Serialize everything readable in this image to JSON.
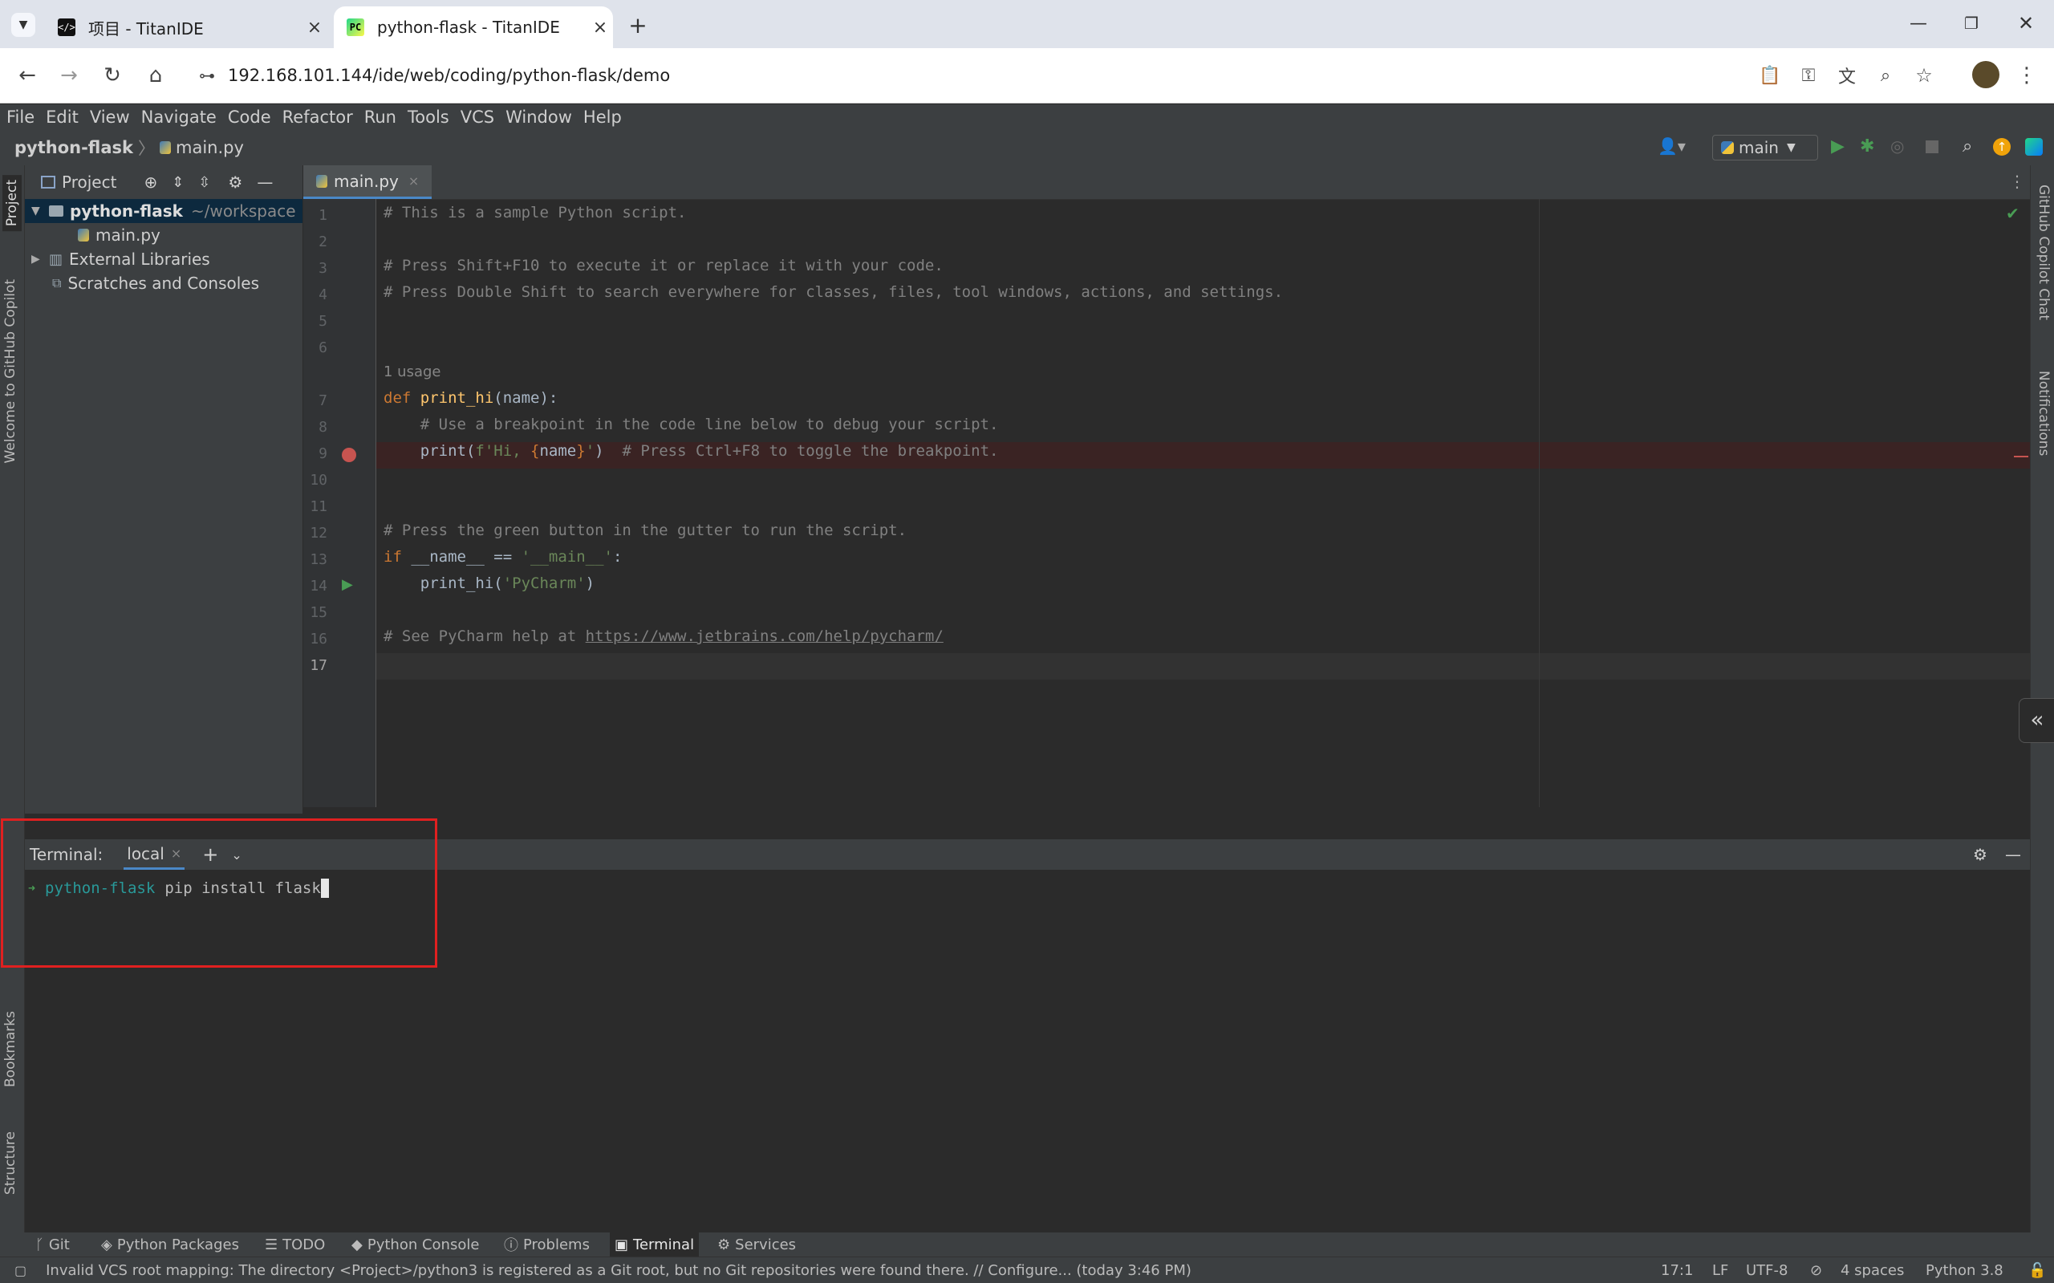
{
  "browser": {
    "tabs": [
      {
        "title": "项目 - TitanIDE",
        "favicon": "titanide-icon"
      },
      {
        "title": "python-flask - TitanIDE",
        "favicon": "pycharm-icon"
      }
    ],
    "url": "192.168.101.144/ide/web/coding/python-flask/demo"
  },
  "ide": {
    "menu": [
      "File",
      "Edit",
      "View",
      "Navigate",
      "Code",
      "Refactor",
      "Run",
      "Tools",
      "VCS",
      "Window",
      "Help"
    ],
    "breadcrumb": {
      "project": "python-flask",
      "file": "main.py"
    },
    "run_config": "main",
    "left_tools": {
      "project": "Project",
      "copilot": "Welcome to GitHub Copilot",
      "bookmarks": "Bookmarks",
      "structure": "Structure"
    },
    "right_tools": {
      "copilot_chat": "GitHub Copilot Chat",
      "notifications": "Notifications"
    },
    "project_panel": {
      "title": "Project",
      "tree": [
        {
          "label": "python-flask",
          "hint": "~/workspace"
        },
        {
          "label": "main.py"
        },
        {
          "label": "External Libraries"
        },
        {
          "label": "Scratches and Consoles"
        }
      ]
    },
    "editor": {
      "tab": "main.py",
      "usage_hint": "1 usage",
      "lines": [
        {
          "n": "1",
          "text": "# This is a sample Python script."
        },
        {
          "n": "2",
          "text": ""
        },
        {
          "n": "3",
          "text": "# Press Shift+F10 to execute it or replace it with your code."
        },
        {
          "n": "4",
          "text": "# Press Double Shift to search everywhere for classes, files, tool windows, actions, and settings."
        },
        {
          "n": "5",
          "text": ""
        },
        {
          "n": "6",
          "text": ""
        },
        {
          "n": "7",
          "text": "def print_hi(name):"
        },
        {
          "n": "8",
          "text": "    # Use a breakpoint in the code line below to debug your script."
        },
        {
          "n": "9",
          "text": "    print(f'Hi, {name}')  # Press Ctrl+F8 to toggle the breakpoint."
        },
        {
          "n": "10",
          "text": ""
        },
        {
          "n": "11",
          "text": ""
        },
        {
          "n": "12",
          "text": "# Press the green button in the gutter to run the script."
        },
        {
          "n": "13",
          "text": "if __name__ == '__main__':"
        },
        {
          "n": "14",
          "text": "    print_hi('PyCharm')"
        },
        {
          "n": "15",
          "text": ""
        },
        {
          "n": "16",
          "text": "# See PyCharm help at https://www.jetbrains.com/help/pycharm/"
        },
        {
          "n": "17",
          "text": ""
        }
      ]
    },
    "terminal": {
      "label": "Terminal:",
      "tab": "local",
      "prompt_arrow": "➜",
      "prompt_dir": "python-flask",
      "command": "pip install flask"
    },
    "bottom_tabs": [
      "Git",
      "Python Packages",
      "TODO",
      "Python Console",
      "Problems",
      "Terminal",
      "Services"
    ],
    "status": {
      "message": "Invalid VCS root mapping: The directory <Project>/python3 is registered as a Git root, but no Git repositories were found there. // Configure... (today 3:46 PM)",
      "position": "17:1",
      "line_sep": "LF",
      "encoding": "UTF-8",
      "indent": "4 spaces",
      "interpreter": "Python 3.8"
    }
  },
  "colors": {
    "highlight_box": "#e02020",
    "accent": "#4a88c7",
    "run_green": "#499c54"
  }
}
